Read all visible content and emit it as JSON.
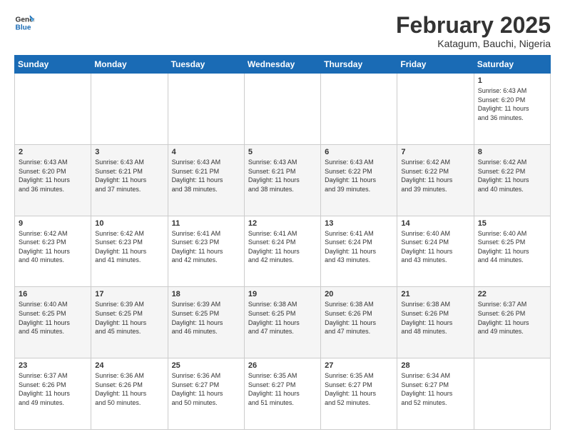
{
  "header": {
    "logo_line1": "General",
    "logo_line2": "Blue",
    "month_year": "February 2025",
    "location": "Katagum, Bauchi, Nigeria"
  },
  "days_of_week": [
    "Sunday",
    "Monday",
    "Tuesday",
    "Wednesday",
    "Thursday",
    "Friday",
    "Saturday"
  ],
  "weeks": [
    [
      {
        "day": "",
        "info": ""
      },
      {
        "day": "",
        "info": ""
      },
      {
        "day": "",
        "info": ""
      },
      {
        "day": "",
        "info": ""
      },
      {
        "day": "",
        "info": ""
      },
      {
        "day": "",
        "info": ""
      },
      {
        "day": "1",
        "info": "Sunrise: 6:43 AM\nSunset: 6:20 PM\nDaylight: 11 hours\nand 36 minutes."
      }
    ],
    [
      {
        "day": "2",
        "info": "Sunrise: 6:43 AM\nSunset: 6:20 PM\nDaylight: 11 hours\nand 36 minutes."
      },
      {
        "day": "3",
        "info": "Sunrise: 6:43 AM\nSunset: 6:21 PM\nDaylight: 11 hours\nand 37 minutes."
      },
      {
        "day": "4",
        "info": "Sunrise: 6:43 AM\nSunset: 6:21 PM\nDaylight: 11 hours\nand 38 minutes."
      },
      {
        "day": "5",
        "info": "Sunrise: 6:43 AM\nSunset: 6:21 PM\nDaylight: 11 hours\nand 38 minutes."
      },
      {
        "day": "6",
        "info": "Sunrise: 6:43 AM\nSunset: 6:22 PM\nDaylight: 11 hours\nand 39 minutes."
      },
      {
        "day": "7",
        "info": "Sunrise: 6:42 AM\nSunset: 6:22 PM\nDaylight: 11 hours\nand 39 minutes."
      },
      {
        "day": "8",
        "info": "Sunrise: 6:42 AM\nSunset: 6:22 PM\nDaylight: 11 hours\nand 40 minutes."
      }
    ],
    [
      {
        "day": "9",
        "info": "Sunrise: 6:42 AM\nSunset: 6:23 PM\nDaylight: 11 hours\nand 40 minutes."
      },
      {
        "day": "10",
        "info": "Sunrise: 6:42 AM\nSunset: 6:23 PM\nDaylight: 11 hours\nand 41 minutes."
      },
      {
        "day": "11",
        "info": "Sunrise: 6:41 AM\nSunset: 6:23 PM\nDaylight: 11 hours\nand 42 minutes."
      },
      {
        "day": "12",
        "info": "Sunrise: 6:41 AM\nSunset: 6:24 PM\nDaylight: 11 hours\nand 42 minutes."
      },
      {
        "day": "13",
        "info": "Sunrise: 6:41 AM\nSunset: 6:24 PM\nDaylight: 11 hours\nand 43 minutes."
      },
      {
        "day": "14",
        "info": "Sunrise: 6:40 AM\nSunset: 6:24 PM\nDaylight: 11 hours\nand 43 minutes."
      },
      {
        "day": "15",
        "info": "Sunrise: 6:40 AM\nSunset: 6:25 PM\nDaylight: 11 hours\nand 44 minutes."
      }
    ],
    [
      {
        "day": "16",
        "info": "Sunrise: 6:40 AM\nSunset: 6:25 PM\nDaylight: 11 hours\nand 45 minutes."
      },
      {
        "day": "17",
        "info": "Sunrise: 6:39 AM\nSunset: 6:25 PM\nDaylight: 11 hours\nand 45 minutes."
      },
      {
        "day": "18",
        "info": "Sunrise: 6:39 AM\nSunset: 6:25 PM\nDaylight: 11 hours\nand 46 minutes."
      },
      {
        "day": "19",
        "info": "Sunrise: 6:38 AM\nSunset: 6:25 PM\nDaylight: 11 hours\nand 47 minutes."
      },
      {
        "day": "20",
        "info": "Sunrise: 6:38 AM\nSunset: 6:26 PM\nDaylight: 11 hours\nand 47 minutes."
      },
      {
        "day": "21",
        "info": "Sunrise: 6:38 AM\nSunset: 6:26 PM\nDaylight: 11 hours\nand 48 minutes."
      },
      {
        "day": "22",
        "info": "Sunrise: 6:37 AM\nSunset: 6:26 PM\nDaylight: 11 hours\nand 49 minutes."
      }
    ],
    [
      {
        "day": "23",
        "info": "Sunrise: 6:37 AM\nSunset: 6:26 PM\nDaylight: 11 hours\nand 49 minutes."
      },
      {
        "day": "24",
        "info": "Sunrise: 6:36 AM\nSunset: 6:26 PM\nDaylight: 11 hours\nand 50 minutes."
      },
      {
        "day": "25",
        "info": "Sunrise: 6:36 AM\nSunset: 6:27 PM\nDaylight: 11 hours\nand 50 minutes."
      },
      {
        "day": "26",
        "info": "Sunrise: 6:35 AM\nSunset: 6:27 PM\nDaylight: 11 hours\nand 51 minutes."
      },
      {
        "day": "27",
        "info": "Sunrise: 6:35 AM\nSunset: 6:27 PM\nDaylight: 11 hours\nand 52 minutes."
      },
      {
        "day": "28",
        "info": "Sunrise: 6:34 AM\nSunset: 6:27 PM\nDaylight: 11 hours\nand 52 minutes."
      },
      {
        "day": "",
        "info": ""
      }
    ]
  ]
}
